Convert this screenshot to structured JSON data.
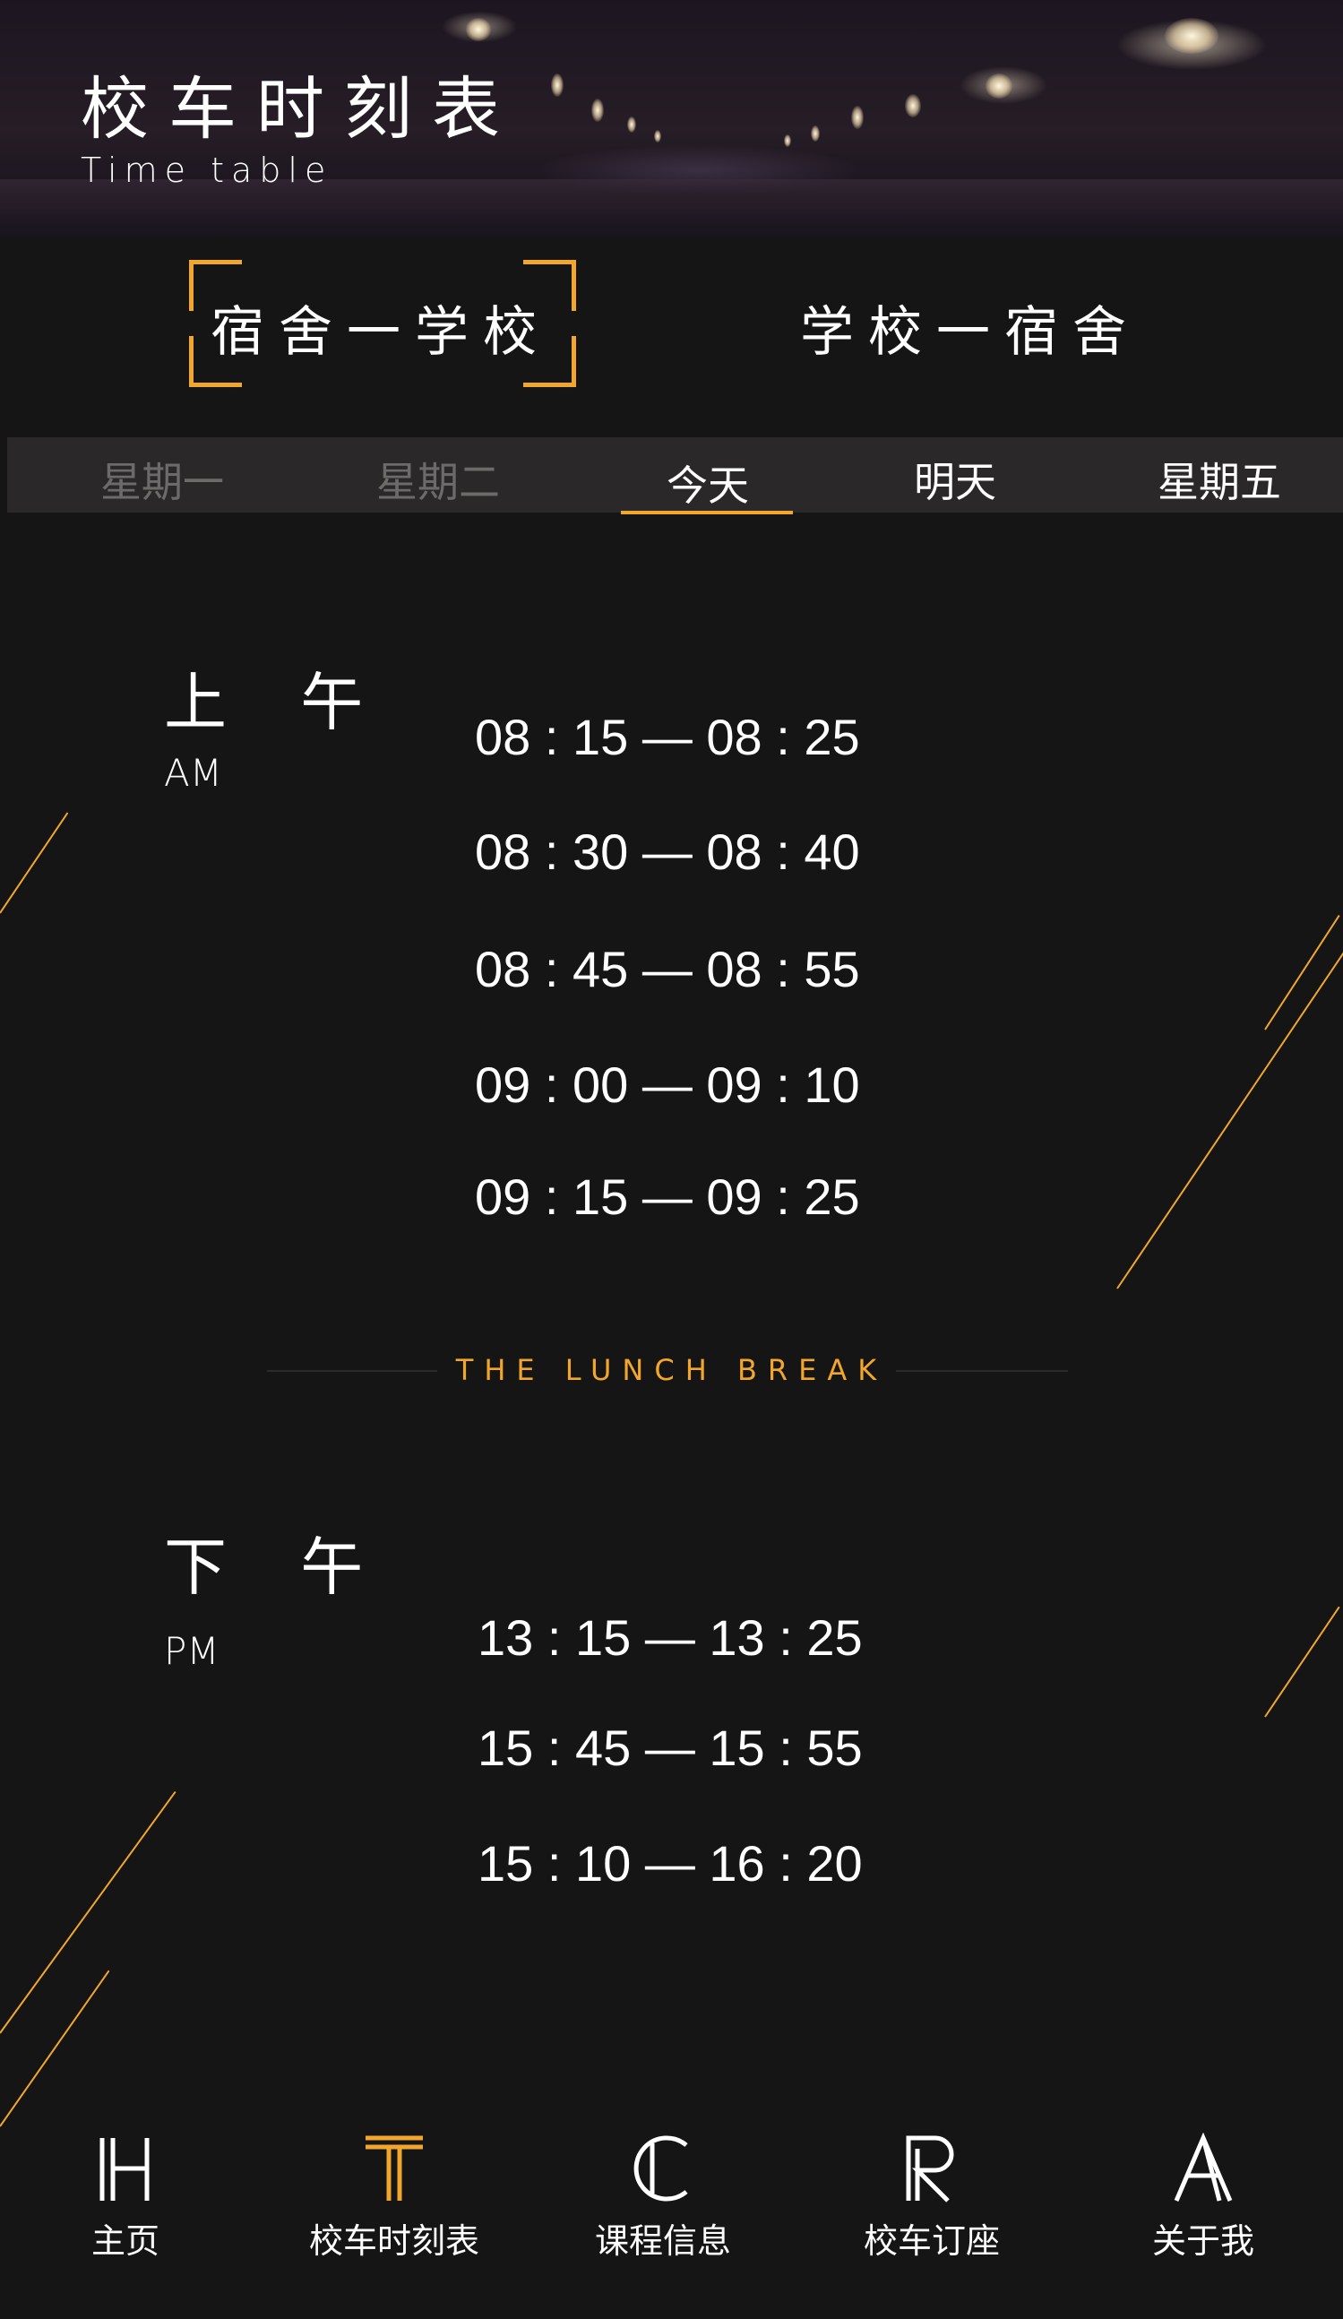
{
  "header": {
    "title": "校车时刻表",
    "subtitle": "Time table"
  },
  "routes": {
    "selected": "宿舍一学校",
    "other": "学校一宿舍"
  },
  "days": [
    {
      "label": "星期一",
      "state": "past"
    },
    {
      "label": "星期二",
      "state": "past"
    },
    {
      "label": "今天",
      "state": "active"
    },
    {
      "label": "明天",
      "state": "upcoming"
    },
    {
      "label": "星期五",
      "state": "upcoming"
    }
  ],
  "morning": {
    "label_cn": "上 午",
    "label_en": "AM",
    "times": [
      "08 : 15 — 08 : 25",
      "08 : 30 — 08 : 40",
      "08 : 45 — 08 : 55",
      "09 : 00 — 09 : 10",
      "09 : 15 — 09 : 25"
    ]
  },
  "lunch_break": "THE LUNCH BREAK",
  "afternoon": {
    "label_cn": "下 午",
    "label_en": "PM",
    "times": [
      "13 : 15 — 13 : 25",
      "15 : 45 — 15 : 55",
      "15 : 10 — 16 : 20"
    ]
  },
  "tabs": [
    {
      "label": "主页",
      "icon": "h-letter-icon",
      "active": false
    },
    {
      "label": "校车时刻表",
      "icon": "t-letter-icon",
      "active": true
    },
    {
      "label": "课程信息",
      "icon": "c-letter-icon",
      "active": false
    },
    {
      "label": "校车订座",
      "icon": "r-letter-icon",
      "active": false
    },
    {
      "label": "关于我",
      "icon": "a-letter-icon",
      "active": false
    }
  ],
  "colors": {
    "background": "#151515",
    "accent": "#f2a72c",
    "day_bar": "#2a2828",
    "muted_text": "#6c6b6a"
  }
}
